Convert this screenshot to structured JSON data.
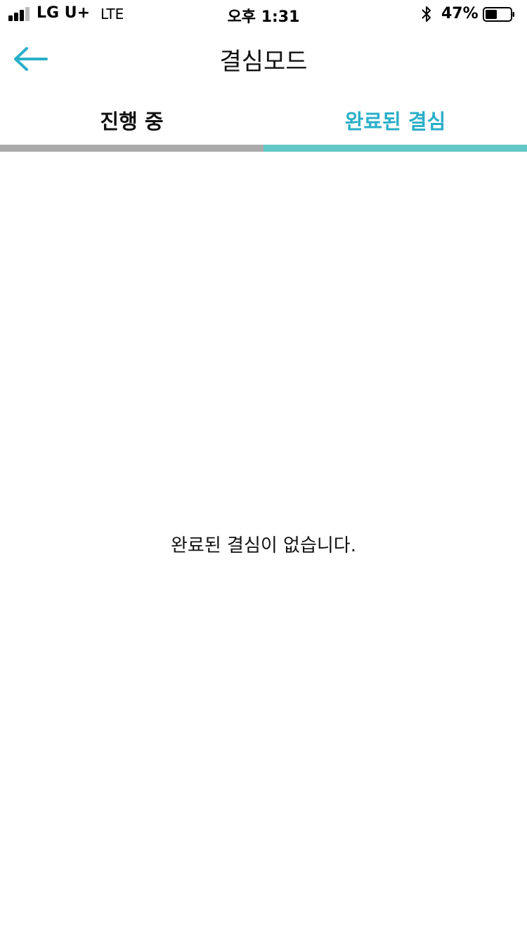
{
  "status_bar": {
    "carrier": "LG U+",
    "network": "LTE",
    "time": "오후 1:31",
    "battery_percent": "47%",
    "battery_level": 0.47,
    "signal_bars": 4
  },
  "header": {
    "back_icon": "arrow-left-icon",
    "title": "결심모드"
  },
  "tabs": [
    {
      "label": "진행 중",
      "active": false
    },
    {
      "label": "완료된 결심",
      "active": true
    }
  ],
  "main": {
    "empty_message": "완료된 결심이 없습니다."
  },
  "colors": {
    "accent": "#2aafc8",
    "active_tab_bar": "#62c8c6",
    "inactive_tab_bar": "#aaaaaa",
    "text": "#111111",
    "background": "#ffffff"
  }
}
